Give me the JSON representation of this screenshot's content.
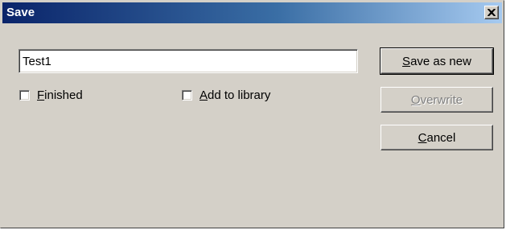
{
  "window": {
    "title": "Save",
    "close_glyph": "✕"
  },
  "name_input": {
    "value": "Test1"
  },
  "checkboxes": [
    {
      "mnemonic": "F",
      "rest": "inished",
      "checked": false
    },
    {
      "mnemonic": "A",
      "rest": "dd to library",
      "checked": false
    }
  ],
  "buttons": {
    "save_as_new": {
      "mnemonic": "S",
      "rest": "ave as new",
      "enabled": true
    },
    "overwrite": {
      "mnemonic": "O",
      "rest": "verwrite",
      "enabled": false
    },
    "cancel": {
      "mnemonic": "C",
      "rest": "ancel",
      "enabled": true
    }
  },
  "colors": {
    "titlebar_start": "#0a246a",
    "titlebar_end": "#a6caf0",
    "face": "#d4d0c8"
  }
}
